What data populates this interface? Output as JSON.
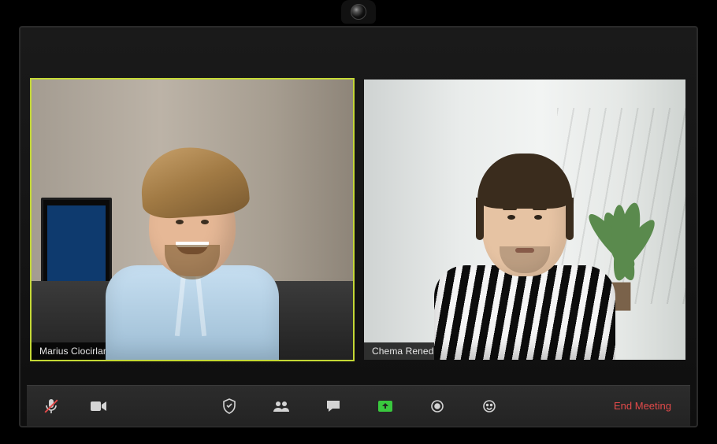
{
  "participants": [
    {
      "name": "Marius Ciocirlan",
      "active": true
    },
    {
      "name": "Chema Renedo",
      "active": false
    }
  ],
  "toolbar": {
    "end_label": "End Meeting"
  },
  "icons": {
    "mic": "mic-muted-icon",
    "video": "video-icon",
    "security": "security-icon",
    "participants": "participants-icon",
    "chat": "chat-icon",
    "share": "share-screen-icon",
    "record": "record-icon",
    "reactions": "reactions-icon"
  },
  "colors": {
    "active_border": "#c4d835",
    "share_green": "#39c83e",
    "end_red": "#e24a4a"
  }
}
